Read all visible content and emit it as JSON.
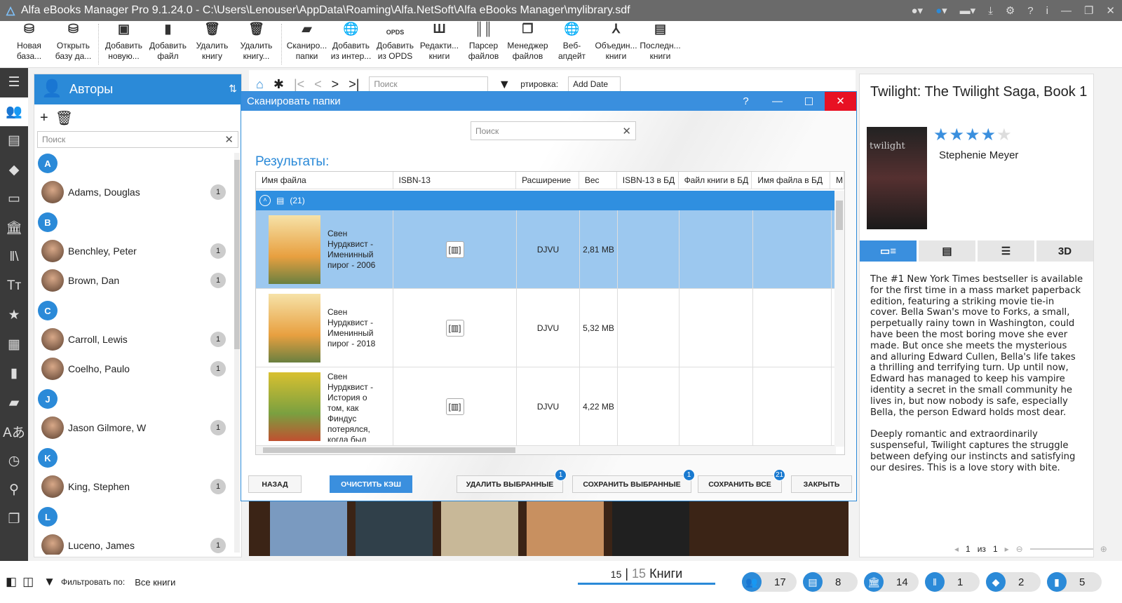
{
  "window": {
    "title": "Alfa eBooks Manager Pro 9.1.24.0 - C:\\Users\\Lenouser\\AppData\\Roaming\\Alfa.NetSoft\\Alfa eBooks Manager\\mylibrary.sdf"
  },
  "toolbar": [
    {
      "icon": "database-add-icon",
      "glyph": "⛁",
      "label": "Новая база..."
    },
    {
      "icon": "database-open-icon",
      "glyph": "⛁",
      "label": "Открыть базу да..."
    },
    {
      "icon": "book-add-icon",
      "glyph": "▣",
      "label": "Добавить новую..."
    },
    {
      "icon": "file-add-icon",
      "glyph": "▮",
      "label": "Добавить файл"
    },
    {
      "icon": "trash-icon",
      "glyph": "🗑",
      "label": "Удалить книгу"
    },
    {
      "icon": "trash-x-icon",
      "glyph": "🗑",
      "label": "Удалить книгу..."
    },
    {
      "icon": "folder-scan-icon",
      "glyph": "▰",
      "label": "Сканиро... папки"
    },
    {
      "icon": "globe-add-icon",
      "glyph": "🌐",
      "label": "Добавить из интер..."
    },
    {
      "icon": "opds-icon",
      "glyph": "OPDS",
      "label": "Добавить из OPDS"
    },
    {
      "icon": "edit-books-icon",
      "glyph": "Ш",
      "label": "Редакти... книги"
    },
    {
      "icon": "barcode-icon",
      "glyph": "║║",
      "label": "Парсер файлов"
    },
    {
      "icon": "files-icon",
      "glyph": "❐",
      "label": "Менеджер файлов"
    },
    {
      "icon": "web-update-icon",
      "glyph": "🌐",
      "label": "Веб-апдейт"
    },
    {
      "icon": "merge-icon",
      "glyph": "⅄",
      "label": "Объедин... книги"
    },
    {
      "icon": "recent-icon",
      "glyph": "▤",
      "label": "Последн... книги"
    }
  ],
  "authors": {
    "title": "Авторы",
    "search_placeholder": "Поиск",
    "groups": [
      {
        "letter": "A",
        "items": [
          {
            "name": "Adams, Douglas",
            "count": "1"
          }
        ]
      },
      {
        "letter": "B",
        "items": [
          {
            "name": "Benchley, Peter",
            "count": "1"
          },
          {
            "name": "Brown, Dan",
            "count": "1"
          }
        ]
      },
      {
        "letter": "C",
        "items": [
          {
            "name": "Carroll, Lewis",
            "count": "1"
          },
          {
            "name": "Coelho, Paulo",
            "count": "1"
          }
        ]
      },
      {
        "letter": "J",
        "items": [
          {
            "name": "Jason Gilmore, W",
            "count": "1"
          }
        ]
      },
      {
        "letter": "K",
        "items": [
          {
            "name": "King, Stephen",
            "count": "1"
          }
        ]
      },
      {
        "letter": "L",
        "items": [
          {
            "name": "Luceno, James",
            "count": "1"
          }
        ]
      }
    ]
  },
  "center": {
    "search_placeholder": "Поиск",
    "sort_label": "ртировка:",
    "sort_value": "Add Date"
  },
  "dialog": {
    "title": "Сканировать папки",
    "search_placeholder": "Поиск",
    "results_label": "Результаты:",
    "columns": [
      "Имя файла",
      "ISBN-13",
      "Расширение",
      "Вес",
      "ISBN-13 в БД",
      "Файл книги в БД",
      "Имя файла в БД",
      "М"
    ],
    "group_count": "(21)",
    "rows": [
      {
        "file": "Свен Нурдквист - Именинный пирог - 2006",
        "ext": "DJVU",
        "size": "2,81 MB",
        "selected": true
      },
      {
        "file": "Свен Нурдквист - Именинный пирог - 2018",
        "ext": "DJVU",
        "size": "5,32 MB",
        "selected": false
      },
      {
        "file": "Свен Нурдквист - История о том, как Финдус потерялся, когда был",
        "ext": "DJVU",
        "size": "4,22 MB",
        "selected": false
      }
    ],
    "buttons": {
      "back": "НАЗАД",
      "clear_cache": "ОЧИСТИТЬ КЭШ",
      "delete_selected": "УДАЛИТЬ ВЫБРАННЫЕ",
      "delete_badge": "1",
      "save_selected": "СОХРАНИТЬ ВЫБРАННЫЕ",
      "save_badge": "1",
      "save_all": "СОХРАНИТЬ ВСЕ",
      "save_all_badge": "21",
      "close": "ЗАКРЫТЬ"
    }
  },
  "book": {
    "title": "Twilight: The Twilight Saga, Book 1",
    "author": "Stephenie Meyer",
    "rating": 4,
    "cover_text": "twilight",
    "tabs": [
      "▭≡",
      "▤",
      "☰",
      "3D"
    ],
    "description": [
      "The #1 New York Times bestseller is available for the first time in a mass market paperback edition, featuring a striking movie tie-in cover. Bella Swan's move to Forks, a small, perpetually rainy town in Washington, could have been the most boring move she ever made. But once she meets the mysterious and alluring Edward Cullen, Bella's life takes a thrilling and terrifying turn. Up until now, Edward has managed to keep his vampire identity a secret in the small community he lives in, but now nobody is safe, especially Bella, the person Edward holds most dear.",
      "Deeply romantic and extraordinarily suspenseful, Twilight captures the struggle between defying our instincts and satisfying our desires. This is a love story with bite."
    ],
    "pager": {
      "current": "1",
      "of": "из",
      "total": "1"
    }
  },
  "status": {
    "filter_label": "Фильтровать по:",
    "filter_value": "Все книги",
    "shown": "15",
    "total": "15",
    "books_label": "Книги",
    "stats": [
      {
        "icon": "authors-icon",
        "glyph": "👥",
        "value": "17"
      },
      {
        "icon": "shelves-icon",
        "glyph": "▤",
        "value": "8"
      },
      {
        "icon": "publishers-icon",
        "glyph": "🏛",
        "value": "14"
      },
      {
        "icon": "series-icon",
        "glyph": "‖",
        "value": "1"
      },
      {
        "icon": "tags-icon",
        "glyph": "◆",
        "value": "2"
      },
      {
        "icon": "files-icon",
        "glyph": "▮",
        "value": "5"
      }
    ]
  },
  "colors": {
    "accent": "#2b8ad8",
    "close": "#e81123",
    "rail": "#3a3a3a"
  }
}
